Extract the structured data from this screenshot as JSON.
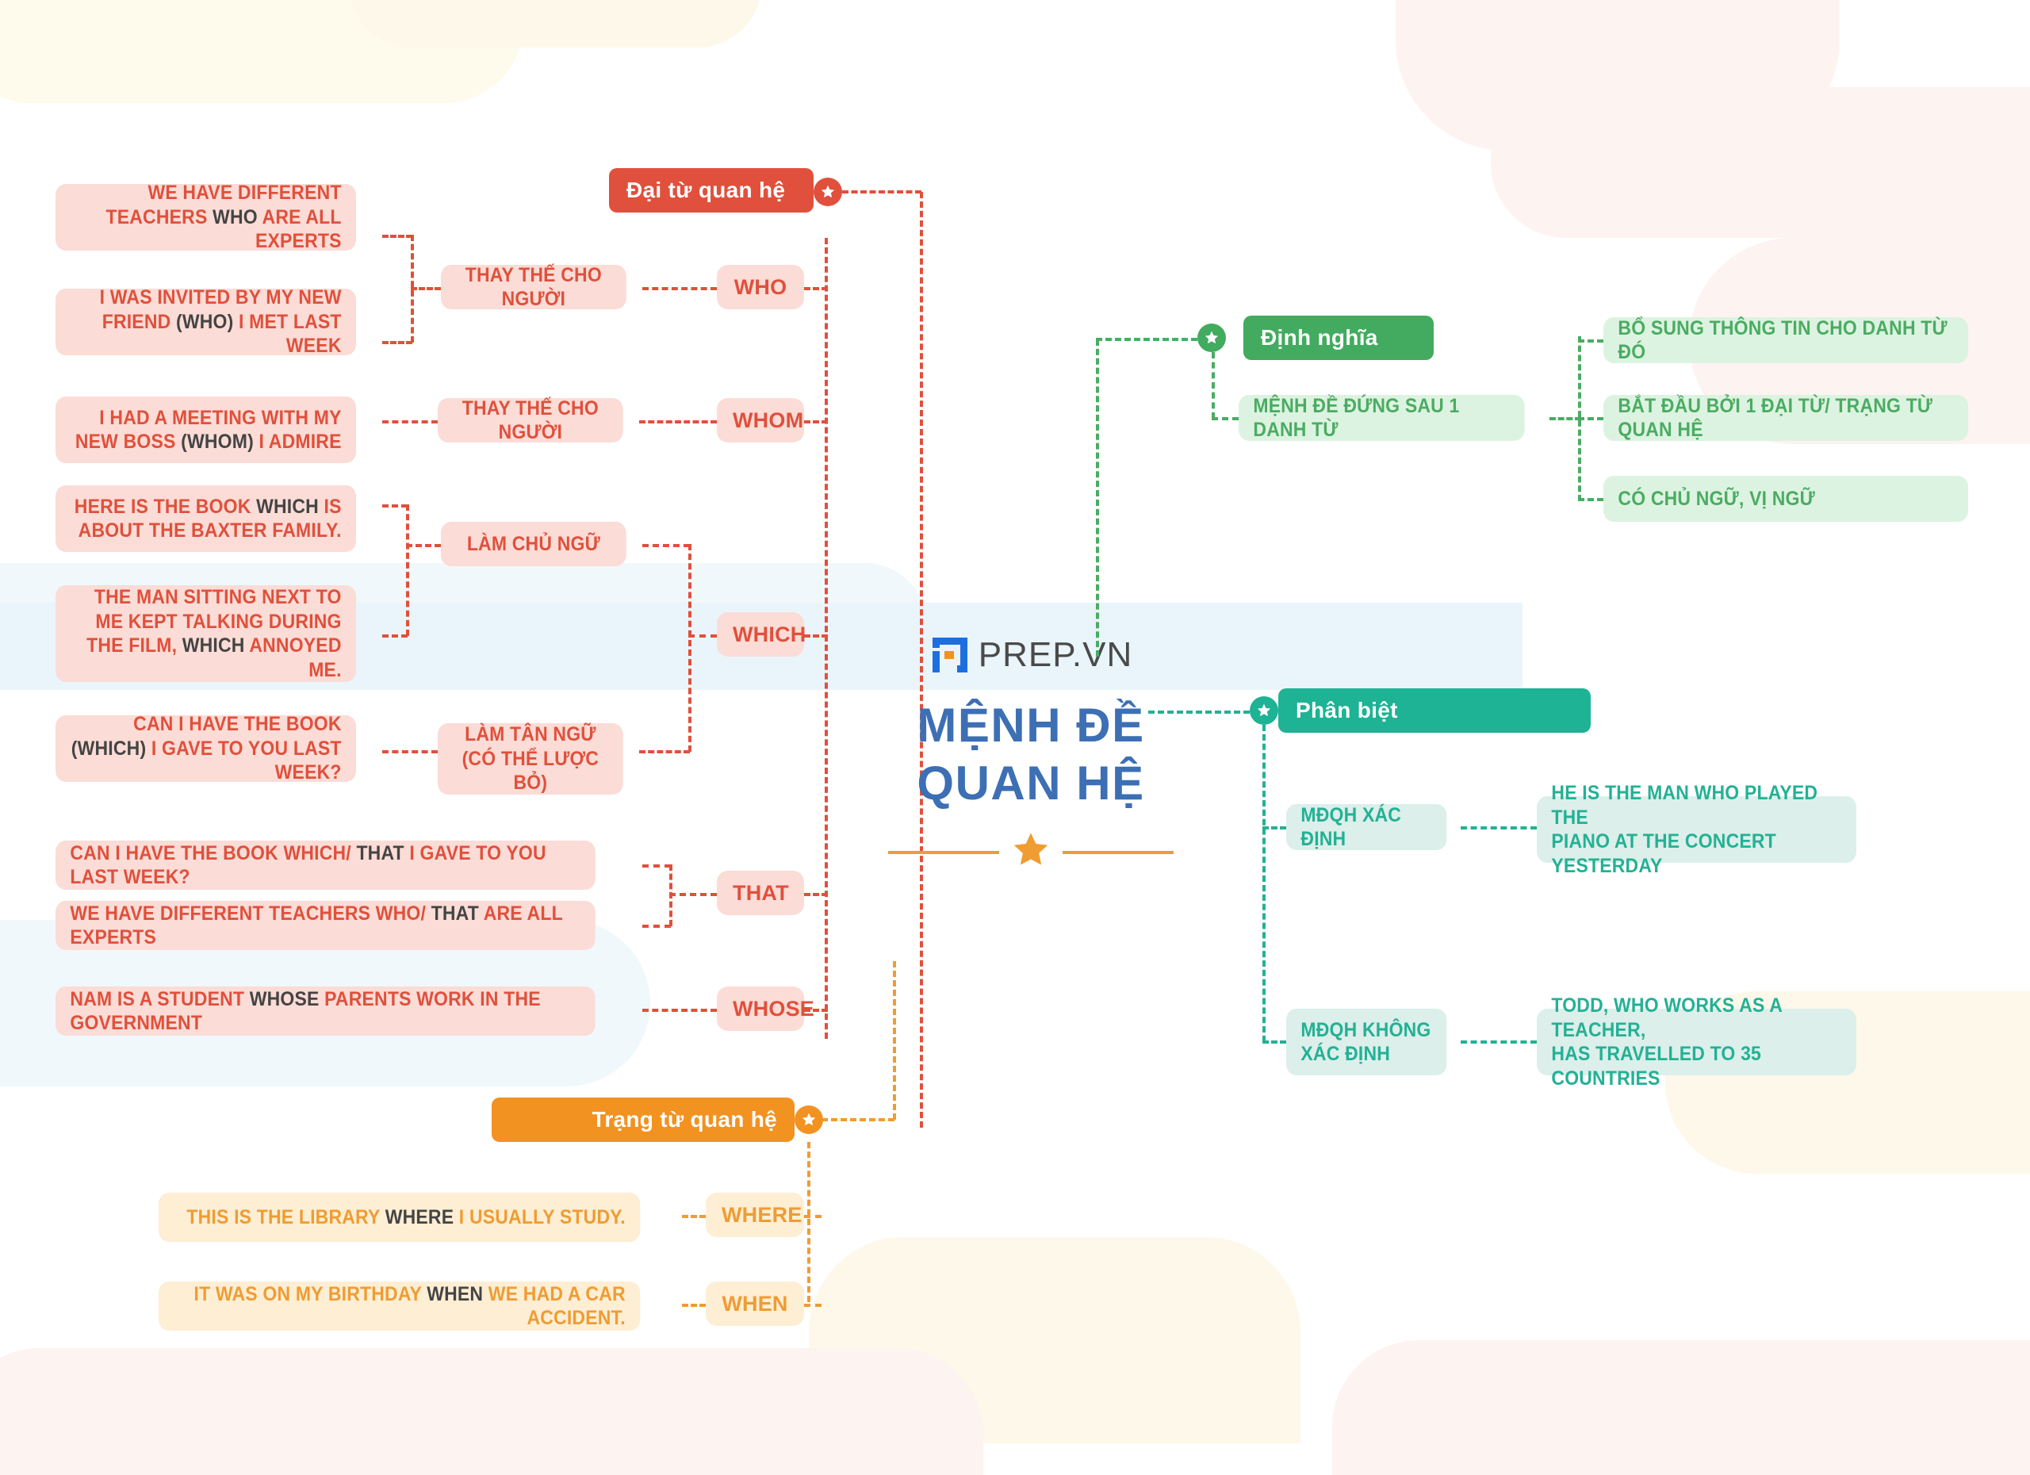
{
  "brand": {
    "logo_text": "PREP.VN",
    "logo_icon": "prep-logo-icon"
  },
  "center": {
    "title_line1": "MỆNH ĐỀ",
    "title_line2": "QUAN HỆ",
    "divider_icon": "star-icon"
  },
  "colors": {
    "red": "#e0503c",
    "red_soft": "#fbdcd6",
    "green": "#42ab5f",
    "green_soft": "#ddf3e1",
    "teal": "#1db394",
    "teal_soft": "#dcefea",
    "orange": "#f29220",
    "orange_soft": "#fdeed4",
    "title_blue": "#3d6fb4",
    "keyword_gray": "#444444"
  },
  "branches": {
    "pronoun": {
      "label": "Đại từ quan hệ",
      "badge_icon": "star-badge-icon",
      "pronouns": [
        {
          "label": "WHO",
          "role": "THAY THẾ CHO NGƯỜI"
        },
        {
          "label": "WHOM",
          "role": "THAY THẾ CHO NGƯỜI"
        },
        {
          "label": "WHICH",
          "role_subject": "LÀM CHỦ NGỮ",
          "role_object_line1": "LÀM TÂN NGỮ",
          "role_object_line2": "(CÓ THỂ LƯỢC BỎ)"
        },
        {
          "label": "THAT"
        },
        {
          "label": "WHOSE"
        }
      ],
      "examples": {
        "who_1": {
          "pre": "WE HAVE DIFFERENT TEACHERS ",
          "kw": "WHO",
          "post": " ARE ALL EXPERTS"
        },
        "who_2": {
          "pre": "I WAS INVITED BY MY NEW FRIEND ",
          "kw": "(WHO)",
          "post": " I MET LAST WEEK"
        },
        "whom_1": {
          "pre": "I HAD A MEETING WITH MY NEW BOSS ",
          "kw": "(WHOM)",
          "post": " I ADMIRE"
        },
        "which_1": {
          "pre": "HERE IS THE BOOK ",
          "kw": "WHICH",
          "post": " IS ABOUT THE BAXTER FAMILY."
        },
        "which_2": {
          "pre": "THE MAN SITTING NEXT TO ME KEPT TALKING DURING THE FILM, ",
          "kw": "WHICH",
          "post": " ANNOYED ME."
        },
        "which_3": {
          "pre": "CAN I HAVE THE BOOK ",
          "kw": "(WHICH)",
          "post": " I GAVE TO YOU LAST WEEK?"
        },
        "that_1": {
          "pre": "CAN I HAVE THE BOOK WHICH/ ",
          "kw": "THAT",
          "post": " I GAVE TO YOU LAST WEEK?"
        },
        "that_2": {
          "pre": "WE HAVE DIFFERENT TEACHERS WHO/ ",
          "kw": "THAT",
          "post": " ARE ALL EXPERTS"
        },
        "whose_1": {
          "pre": "NAM IS A STUDENT ",
          "kw": "WHOSE",
          "post": " PARENTS WORK IN THE GOVERNMENT"
        }
      }
    },
    "adverb": {
      "label": "Trạng từ quan hệ",
      "badge_icon": "star-badge-icon",
      "adverbs": [
        {
          "label": "WHERE"
        },
        {
          "label": "WHEN"
        }
      ],
      "examples": {
        "where_1": {
          "pre": "THIS IS THE LIBRARY ",
          "kw": "WHERE",
          "post": " I USUALLY STUDY."
        },
        "when_1": {
          "pre": "IT WAS ON MY BIRTHDAY ",
          "kw": "WHEN",
          "post": " WE HAD A CAR ACCIDENT."
        }
      }
    },
    "definition": {
      "label": "Định nghĩa",
      "badge_icon": "star-badge-icon",
      "items": [
        {
          "label": "MỆNH ĐỀ ĐỨNG SAU 1 DANH TỪ"
        }
      ],
      "details": [
        {
          "label": "BỔ SUNG THÔNG TIN CHO DANH TỪ ĐÓ"
        },
        {
          "label": "BẮT ĐẦU BỞI 1 ĐẠI TỪ/ TRẠNG TỪ QUAN HỆ"
        },
        {
          "label": "CÓ CHỦ NGỮ, VỊ NGỮ"
        }
      ]
    },
    "distinction": {
      "label": "Phân biệt",
      "badge_icon": "star-badge-icon",
      "types": [
        {
          "label": "MĐQH XÁC ĐỊNH",
          "example_line1": "HE IS THE MAN WHO PLAYED THE",
          "example_line2": "PIANO AT THE CONCERT YESTERDAY"
        },
        {
          "label_line1": "MĐQH KHÔNG",
          "label_line2": "XÁC ĐỊNH",
          "example_line1": "TODD, WHO WORKS AS A TEACHER,",
          "example_line2": "HAS TRAVELLED TO 35 COUNTRIES"
        }
      ]
    }
  }
}
